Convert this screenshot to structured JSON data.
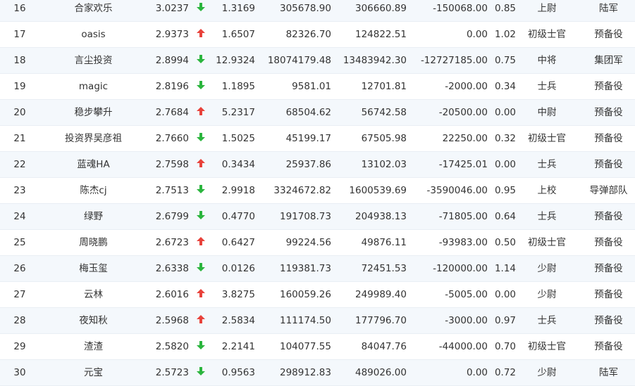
{
  "colors": {
    "up": "#e8423b",
    "down": "#2bb53e",
    "row_stripe": "#f4f8fc"
  },
  "rows": [
    {
      "rank": "16",
      "name": "合家欢乐",
      "score": "3.0237",
      "trend": "down",
      "ratio": "1.3169",
      "val1": "305678.90",
      "val2": "306660.89",
      "val3": "-150068.00",
      "pct": "0.85",
      "rank_title": "上尉",
      "unit": "陆军"
    },
    {
      "rank": "17",
      "name": "oasis",
      "score": "2.9373",
      "trend": "up",
      "ratio": "1.6507",
      "val1": "82326.70",
      "val2": "124822.51",
      "val3": "0.00",
      "pct": "1.02",
      "rank_title": "初级士官",
      "unit": "预备役"
    },
    {
      "rank": "18",
      "name": "言尘投资",
      "score": "2.8994",
      "trend": "down",
      "ratio": "12.9324",
      "val1": "18074179.48",
      "val2": "13483942.30",
      "val3": "-12727185.00",
      "pct": "0.75",
      "rank_title": "中将",
      "unit": "集团军"
    },
    {
      "rank": "19",
      "name": "magic",
      "score": "2.8196",
      "trend": "down",
      "ratio": "1.1895",
      "val1": "9581.01",
      "val2": "12701.81",
      "val3": "-2000.00",
      "pct": "0.34",
      "rank_title": "士兵",
      "unit": "预备役"
    },
    {
      "rank": "20",
      "name": "稳步攀升",
      "score": "2.7684",
      "trend": "up",
      "ratio": "5.2317",
      "val1": "68504.62",
      "val2": "56742.58",
      "val3": "-20500.00",
      "pct": "0.00",
      "rank_title": "中尉",
      "unit": "预备役"
    },
    {
      "rank": "21",
      "name": "投资界吴彦祖",
      "score": "2.7660",
      "trend": "down",
      "ratio": "1.5025",
      "val1": "45199.17",
      "val2": "67505.98",
      "val3": "22250.00",
      "pct": "0.32",
      "rank_title": "初级士官",
      "unit": "预备役"
    },
    {
      "rank": "22",
      "name": "蓝魂HA",
      "score": "2.7598",
      "trend": "up",
      "ratio": "0.3434",
      "val1": "25937.86",
      "val2": "13102.03",
      "val3": "-17425.01",
      "pct": "0.00",
      "rank_title": "士兵",
      "unit": "预备役"
    },
    {
      "rank": "23",
      "name": "陈杰cj",
      "score": "2.7513",
      "trend": "down",
      "ratio": "2.9918",
      "val1": "3324672.82",
      "val2": "1600539.69",
      "val3": "-3590046.00",
      "pct": "0.95",
      "rank_title": "上校",
      "unit": "导弹部队"
    },
    {
      "rank": "24",
      "name": "绿野",
      "score": "2.6799",
      "trend": "down",
      "ratio": "0.4770",
      "val1": "191708.73",
      "val2": "204938.13",
      "val3": "-71805.00",
      "pct": "0.64",
      "rank_title": "士兵",
      "unit": "预备役"
    },
    {
      "rank": "25",
      "name": "周晓鹏",
      "score": "2.6723",
      "trend": "up",
      "ratio": "0.6427",
      "val1": "99224.56",
      "val2": "49876.11",
      "val3": "-93983.00",
      "pct": "0.50",
      "rank_title": "初级士官",
      "unit": "预备役"
    },
    {
      "rank": "26",
      "name": "梅玉玺",
      "score": "2.6338",
      "trend": "down",
      "ratio": "0.0126",
      "val1": "119381.73",
      "val2": "72451.53",
      "val3": "-120000.00",
      "pct": "1.14",
      "rank_title": "少尉",
      "unit": "预备役"
    },
    {
      "rank": "27",
      "name": "云林",
      "score": "2.6016",
      "trend": "up",
      "ratio": "3.8275",
      "val1": "160059.26",
      "val2": "249989.40",
      "val3": "-5005.00",
      "pct": "0.00",
      "rank_title": "少尉",
      "unit": "预备役"
    },
    {
      "rank": "28",
      "name": "夜知秋",
      "score": "2.5968",
      "trend": "up",
      "ratio": "2.5834",
      "val1": "111174.50",
      "val2": "177796.70",
      "val3": "-3000.00",
      "pct": "0.97",
      "rank_title": "士兵",
      "unit": "预备役"
    },
    {
      "rank": "29",
      "name": "渣渣",
      "score": "2.5820",
      "trend": "down",
      "ratio": "2.2141",
      "val1": "104077.55",
      "val2": "84047.76",
      "val3": "-44000.00",
      "pct": "0.70",
      "rank_title": "初级士官",
      "unit": "预备役"
    },
    {
      "rank": "30",
      "name": "元宝",
      "score": "2.5723",
      "trend": "down",
      "ratio": "0.9563",
      "val1": "298912.83",
      "val2": "489026.00",
      "val3": "0.00",
      "pct": "0.72",
      "rank_title": "少尉",
      "unit": "陆军"
    }
  ]
}
